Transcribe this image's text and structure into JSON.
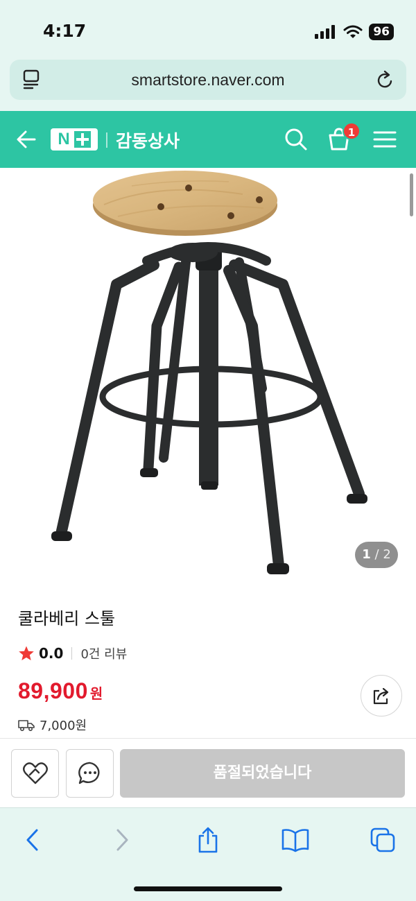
{
  "status": {
    "time": "4:17",
    "battery": "96"
  },
  "browser": {
    "url": "smartstore.naver.com"
  },
  "header": {
    "store_name": "감동상사",
    "cart_count": "1"
  },
  "gallery": {
    "current": "1",
    "separator": "/",
    "total": "2"
  },
  "product": {
    "title": "쿨라베리 스툴",
    "rating": "0.0",
    "review_count": "0건 리뷰",
    "price": "89,900",
    "price_unit": "원",
    "shipping_fee": "7,000원"
  },
  "actions": {
    "soldout_label": "품절되었습니다"
  },
  "colors": {
    "brand": "#2dc5a3",
    "price": "#e21a2d",
    "star": "#ef3b36",
    "safari_bg": "#e6f6f2",
    "safari_blue": "#1a73e8"
  },
  "icons": [
    "back-arrow-icon",
    "search-icon",
    "cart-icon",
    "menu-icon",
    "reader-icon",
    "reload-icon",
    "star-icon",
    "share-icon",
    "truck-icon",
    "heart-icon",
    "chat-icon",
    "safari-back-icon",
    "safari-forward-icon",
    "safari-share-icon",
    "bookmarks-icon",
    "tabs-icon"
  ]
}
